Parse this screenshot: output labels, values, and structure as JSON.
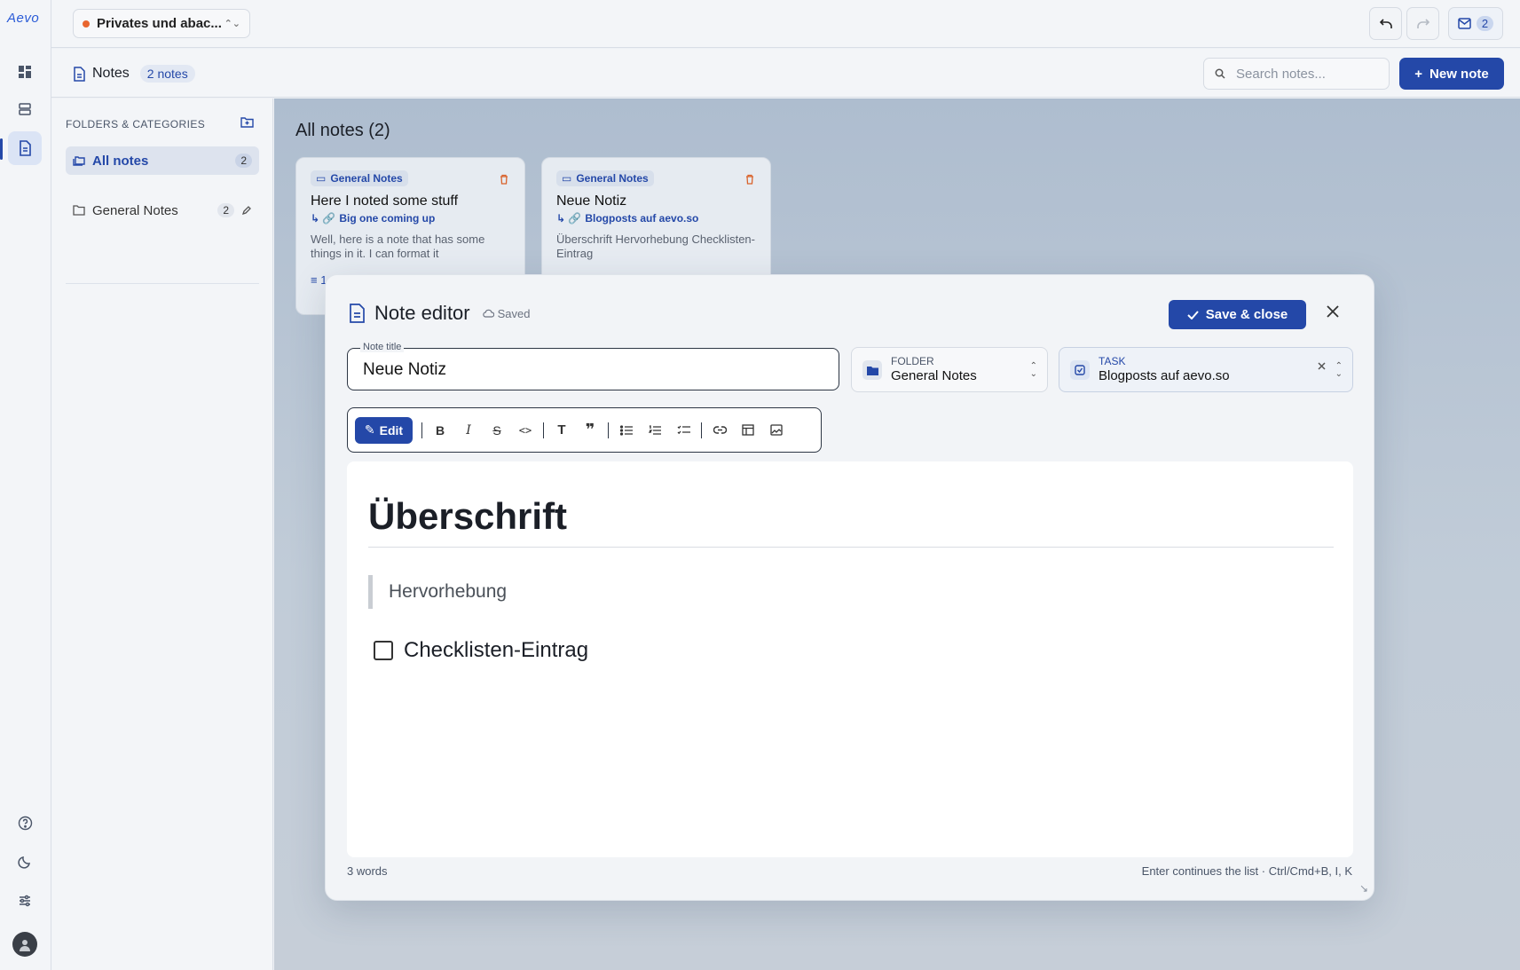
{
  "app": {
    "logo": "Aevo",
    "workspace": "Privates und abac...",
    "inbox_count": "2"
  },
  "header": {
    "title": "Notes",
    "count": "2 notes",
    "search_placeholder": "Search notes...",
    "new_note": "New note"
  },
  "folders": {
    "heading": "FOLDERS & CATEGORIES",
    "items": [
      {
        "label": "All notes",
        "count": "2"
      },
      {
        "label": "General Notes",
        "count": "2"
      }
    ]
  },
  "main": {
    "title": "All notes (2)",
    "cards": [
      {
        "tag": "General Notes",
        "title": "Here I noted some stuff",
        "link": "Big one coming up",
        "body": "Well, here is a note that has some things in it. I can format it",
        "footer": "≡ 1"
      },
      {
        "tag": "General Notes",
        "title": "Neue Notiz",
        "link": "Blogposts auf aevo.so",
        "body": "Überschrift Hervorhebung Checklisten-Eintrag"
      }
    ]
  },
  "editor": {
    "title": "Note editor",
    "status": "Saved",
    "save_close": "Save & close",
    "note_title_label": "Note title",
    "note_title": "Neue Notiz",
    "folder_label": "FOLDER",
    "folder_value": "General Notes",
    "task_label": "TASK",
    "task_value": "Blogposts auf aevo.so",
    "edit_label": "Edit",
    "content": {
      "heading": "Überschrift",
      "quote": "Hervorhebung",
      "checklist_item": "Checklisten-Eintrag"
    },
    "word_count": "3 words",
    "hint": "Enter continues the list · Ctrl/Cmd+B, I, K"
  },
  "colors": {
    "primary": "#2448a8",
    "accent_dot": "#e8662f"
  }
}
